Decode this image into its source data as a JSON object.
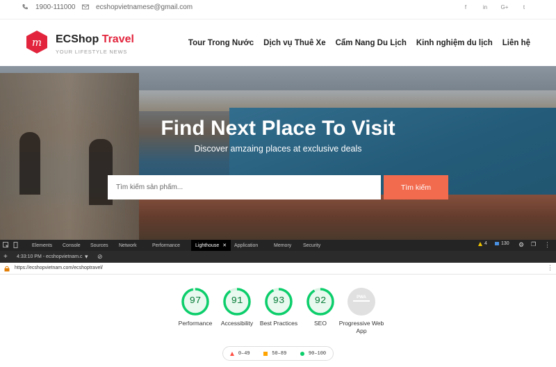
{
  "topbar": {
    "phone": "1900-111000",
    "email": "ecshopvietnamese@gmail.com",
    "social": [
      "f",
      "in",
      "G+",
      "t"
    ]
  },
  "header": {
    "brand_main": "ECShop",
    "brand_accent": "Travel",
    "tagline": "YOUR LIFESTYLE NEWS",
    "nav": [
      "Tour Trong Nước",
      "Dịch vụ Thuê Xe",
      "Cẩm Nang Du Lịch",
      "Kinh nghiệm du lịch",
      "Liên hệ"
    ]
  },
  "hero": {
    "title": "Find Next Place To Visit",
    "subtitle": "Discover amzaing places at exclusive deals",
    "search_placeholder": "Tìm kiếm sản phẩm...",
    "search_button": "Tìm kiếm"
  },
  "devtools": {
    "tabs": [
      "Elements",
      "Console",
      "Sources",
      "Network",
      "Performance",
      "Lighthouse",
      "Application",
      "Memory",
      "Security"
    ],
    "active_tab": "Lighthouse",
    "warnings": "4",
    "messages": "130",
    "report_label": "4:33:10 PM - ecshopvietnam.c",
    "url": "https://ecshopvietnam.com/ecshoptravel/"
  },
  "lighthouse": {
    "scores": [
      {
        "label": "Performance",
        "value": 97
      },
      {
        "label": "Accessibility",
        "value": 91
      },
      {
        "label": "Best Practices",
        "value": 93
      },
      {
        "label": "SEO",
        "value": 92
      }
    ],
    "pwa_label": "Progressive Web App",
    "pwa_badge": "PWA",
    "legend": [
      "0–49",
      "50–89",
      "90–100"
    ]
  },
  "colors": {
    "brand_accent": "#e2253d",
    "search_button": "#f26b4f",
    "score_good": "#0cce6b",
    "score_text": "#0a7d3a"
  }
}
